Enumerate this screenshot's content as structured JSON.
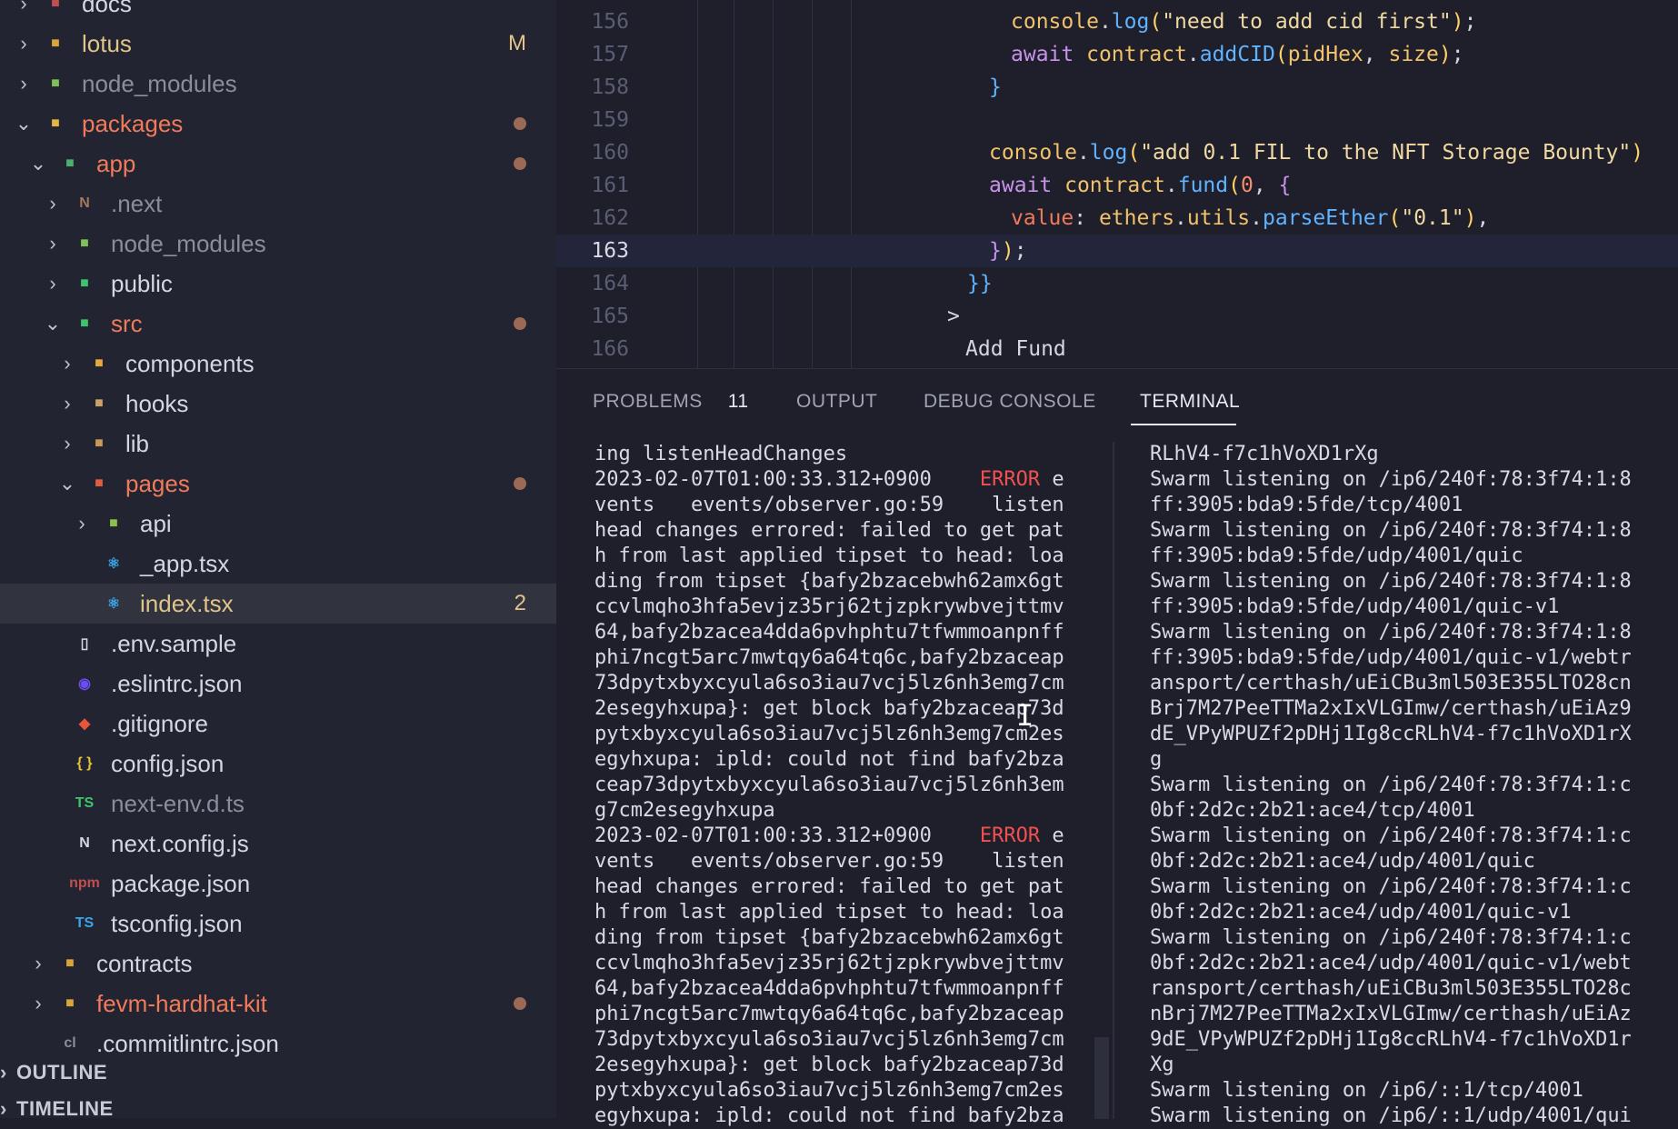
{
  "explorer": {
    "items": [
      {
        "label": "docs",
        "chev": "›",
        "icon_color": "#c0504f",
        "icon_glyph": "■",
        "color": "#d5d7e0"
      },
      {
        "label": "lotus",
        "chev": "›",
        "icon_color": "#d9a53a",
        "icon_glyph": "■",
        "badge": "M",
        "color": "#e0c48a"
      },
      {
        "label": "node_modules",
        "chev": "›",
        "icon_color": "#7ec15a",
        "icon_glyph": "■",
        "color": "#8a8e9c"
      },
      {
        "label": "packages",
        "chev": "⌄",
        "icon_color": "#e7b443",
        "icon_glyph": "■",
        "dot": true,
        "color": "#f07a5a"
      },
      {
        "label": "app",
        "chev": "⌄",
        "icon_color": "#4caf70",
        "icon_glyph": "■",
        "dot": true,
        "color": "#f07a5a"
      },
      {
        "label": ".next",
        "chev": "›",
        "icon_color": "#a07a5a",
        "icon_glyph": "N",
        "color": "#8a8e9c"
      },
      {
        "label": "node_modules",
        "chev": "›",
        "icon_color": "#7ec15a",
        "icon_glyph": "■",
        "color": "#8a8e9c"
      },
      {
        "label": "public",
        "chev": "›",
        "icon_color": "#3ec46a",
        "icon_glyph": "■",
        "color": "#d5d7e0"
      },
      {
        "label": "src",
        "chev": "⌄",
        "icon_color": "#3ec46a",
        "icon_glyph": "■",
        "dot": true,
        "color": "#f07a5a"
      },
      {
        "label": "components",
        "chev": "›",
        "icon_color": "#e7a73b",
        "icon_glyph": "■",
        "color": "#d5d7e0"
      },
      {
        "label": "hooks",
        "chev": "›",
        "icon_color": "#c9a36a",
        "icon_glyph": "■",
        "color": "#d5d7e0"
      },
      {
        "label": "lib",
        "chev": "›",
        "icon_color": "#c89a5a",
        "icon_glyph": "■",
        "color": "#d5d7e0"
      },
      {
        "label": "pages",
        "chev": "⌄",
        "icon_color": "#e25c3f",
        "icon_glyph": "■",
        "dot": true,
        "color": "#f07a5a"
      },
      {
        "label": "api",
        "chev": "›",
        "icon_color": "#8cc04a",
        "icon_glyph": "■",
        "color": "#d5d7e0"
      },
      {
        "label": "_app.tsx",
        "chev": "",
        "icon_color": "#3aa6e8",
        "icon_glyph": "⚛",
        "color": "#d5d7e0"
      },
      {
        "label": "index.tsx",
        "chev": "",
        "icon_color": "#3aa6e8",
        "icon_glyph": "⚛",
        "badge": "2",
        "color": "#e0c48a",
        "selected": true
      },
      {
        "label": ".env.sample",
        "chev": "",
        "icon_color": "#d5d7e0",
        "icon_glyph": "▯",
        "color": "#d5d7e0"
      },
      {
        "label": ".eslintrc.json",
        "chev": "",
        "icon_color": "#6a4cf0",
        "icon_glyph": "◉",
        "color": "#d5d7e0"
      },
      {
        "label": ".gitignore",
        "chev": "",
        "icon_color": "#e8553a",
        "icon_glyph": "◆",
        "color": "#d5d7e0"
      },
      {
        "label": "config.json",
        "chev": "",
        "icon_color": "#e7c23b",
        "icon_glyph": "{ }",
        "color": "#d5d7e0"
      },
      {
        "label": "next-env.d.ts",
        "chev": "",
        "icon_color": "#3ec46a",
        "icon_glyph": "TS",
        "color": "#8a8e9c"
      },
      {
        "label": "next.config.js",
        "chev": "",
        "icon_color": "#d5d7e0",
        "icon_glyph": "N",
        "color": "#d5d7e0"
      },
      {
        "label": "package.json",
        "chev": "",
        "icon_color": "#c0504f",
        "icon_glyph": "npm",
        "color": "#d5d7e0"
      },
      {
        "label": "tsconfig.json",
        "chev": "",
        "icon_color": "#3aa6e8",
        "icon_glyph": "TS",
        "color": "#d5d7e0"
      },
      {
        "label": "contracts",
        "chev": "›",
        "icon_color": "#d9a53a",
        "icon_glyph": "■",
        "color": "#d5d7e0"
      },
      {
        "label": "fevm-hardhat-kit",
        "chev": "›",
        "icon_color": "#d9a53a",
        "icon_glyph": "■",
        "dot": true,
        "color": "#f07a5a"
      },
      {
        "label": ".commitlintrc.json",
        "chev": "",
        "icon_color": "#8a8e9c",
        "icon_glyph": "cl",
        "color": "#d5d7e0"
      }
    ],
    "outline_label": "OUTLINE",
    "timeline_label": "TIMELINE"
  },
  "editor": {
    "current_line": "163",
    "lines": [
      {
        "num": "156",
        "tokens": [
          [
            "console",
            "t-obj"
          ],
          [
            ".",
            "t-pun"
          ],
          [
            "log",
            "t-fn"
          ],
          [
            "(",
            "t-brk"
          ],
          [
            "\"need to add cid first\"",
            "t-str"
          ],
          [
            ")",
            "t-brk"
          ],
          [
            ";",
            "t-pun"
          ]
        ]
      },
      {
        "num": "157",
        "tokens": [
          [
            "await ",
            "t-kw"
          ],
          [
            "contract",
            "t-obj"
          ],
          [
            ".",
            "t-pun"
          ],
          [
            "addCID",
            "t-fn"
          ],
          [
            "(",
            "t-brk"
          ],
          [
            "pidHex",
            "t-obj"
          ],
          [
            ", ",
            "t-pun"
          ],
          [
            "size",
            "t-obj"
          ],
          [
            ")",
            "t-brk"
          ],
          [
            ";",
            "t-pun"
          ]
        ]
      },
      {
        "num": "158",
        "tokens": [
          [
            "}",
            "t-brk2"
          ]
        ]
      },
      {
        "num": "159",
        "tokens": []
      },
      {
        "num": "160",
        "tokens": [
          [
            "console",
            "t-obj"
          ],
          [
            ".",
            "t-pun"
          ],
          [
            "log",
            "t-fn"
          ],
          [
            "(",
            "t-brk"
          ],
          [
            "\"add 0.1 FIL to the NFT Storage Bounty\"",
            "t-str"
          ],
          [
            ")",
            "t-brk"
          ]
        ]
      },
      {
        "num": "161",
        "tokens": [
          [
            "await ",
            "t-kw"
          ],
          [
            "contract",
            "t-obj"
          ],
          [
            ".",
            "t-pun"
          ],
          [
            "fund",
            "t-fn"
          ],
          [
            "(",
            "t-brk"
          ],
          [
            "0",
            "t-num"
          ],
          [
            ", ",
            "t-pun"
          ],
          [
            "{",
            "t-kw"
          ]
        ]
      },
      {
        "num": "162",
        "tokens": [
          [
            "value",
            "t-prop"
          ],
          [
            ": ",
            "t-pun"
          ],
          [
            "ethers",
            "t-obj"
          ],
          [
            ".",
            "t-pun"
          ],
          [
            "utils",
            "t-obj"
          ],
          [
            ".",
            "t-pun"
          ],
          [
            "parseEther",
            "t-fn"
          ],
          [
            "(",
            "t-brk"
          ],
          [
            "\"0.1\"",
            "t-str"
          ],
          [
            ")",
            "t-brk"
          ],
          [
            ",",
            "t-pun"
          ]
        ]
      },
      {
        "num": "163",
        "tokens": [
          [
            "}",
            "t-kw"
          ],
          [
            ")",
            "t-brk"
          ],
          [
            ";",
            "t-pun"
          ]
        ]
      },
      {
        "num": "164",
        "tokens": [
          [
            "}}",
            "t-brk2"
          ]
        ]
      },
      {
        "num": "165",
        "tokens": [
          [
            ">",
            "t-pun"
          ]
        ]
      },
      {
        "num": "166",
        "tokens": [
          [
            "Add Fund",
            "t-pun"
          ]
        ]
      }
    ]
  },
  "panel": {
    "tabs": [
      {
        "label": "PROBLEMS",
        "count": "11"
      },
      {
        "label": "OUTPUT"
      },
      {
        "label": "DEBUG CONSOLE"
      },
      {
        "label": "TERMINAL",
        "active": true
      }
    ],
    "terminal_left": [
      [
        [
          "ing listenHeadChanges",
          ""
        ]
      ],
      [
        [
          "2023-02-07T01:00:33.312+0900    ",
          ""
        ],
        [
          "ERROR",
          "err"
        ],
        [
          " e",
          ""
        ]
      ],
      [
        [
          "vents   events/observer.go:59    listen",
          ""
        ]
      ],
      [
        [
          "head changes errored: failed to get pat",
          ""
        ]
      ],
      [
        [
          "h from last applied tipset to head: loa",
          ""
        ]
      ],
      [
        [
          "ding from tipset {bafy2bzacebwh62amx6gt",
          ""
        ]
      ],
      [
        [
          "ccvlmqho3hfa5evjz35rj62tjzpkrywbvejttmv",
          ""
        ]
      ],
      [
        [
          "64,bafy2bzacea4dda6pvhphtu7tfwmmoanpnff",
          ""
        ]
      ],
      [
        [
          "phi7ncgt5arc7mwtqy6a64tq6c,bafy2bzaceap",
          ""
        ]
      ],
      [
        [
          "73dpytxbyxcyula6so3iau7vcj5lz6nh3emg7cm",
          ""
        ]
      ],
      [
        [
          "2esegyhxupa}: get block bafy2bzaceap73d",
          ""
        ]
      ],
      [
        [
          "pytxbyxcyula6so3iau7vcj5lz6nh3emg7cm2es",
          ""
        ]
      ],
      [
        [
          "egyhxupa: ipld: could not find bafy2bza",
          ""
        ]
      ],
      [
        [
          "ceap73dpytxbyxcyula6so3iau7vcj5lz6nh3em",
          ""
        ]
      ],
      [
        [
          "g7cm2esegyhxupa",
          ""
        ]
      ],
      [
        [
          "2023-02-07T01:00:33.312+0900    ",
          ""
        ],
        [
          "ERROR",
          "err"
        ],
        [
          " e",
          ""
        ]
      ],
      [
        [
          "vents   events/observer.go:59    listen",
          ""
        ]
      ],
      [
        [
          "head changes errored: failed to get pat",
          ""
        ]
      ],
      [
        [
          "h from last applied tipset to head: loa",
          ""
        ]
      ],
      [
        [
          "ding from tipset {bafy2bzacebwh62amx6gt",
          ""
        ]
      ],
      [
        [
          "ccvlmqho3hfa5evjz35rj62tjzpkrywbvejttmv",
          ""
        ]
      ],
      [
        [
          "64,bafy2bzacea4dda6pvhphtu7tfwmmoanpnff",
          ""
        ]
      ],
      [
        [
          "phi7ncgt5arc7mwtqy6a64tq6c,bafy2bzaceap",
          ""
        ]
      ],
      [
        [
          "73dpytxbyxcyula6so3iau7vcj5lz6nh3emg7cm",
          ""
        ]
      ],
      [
        [
          "2esegyhxupa}: get block bafy2bzaceap73d",
          ""
        ]
      ],
      [
        [
          "pytxbyxcyula6so3iau7vcj5lz6nh3emg7cm2es",
          ""
        ]
      ],
      [
        [
          "egyhxupa: ipld: could not find bafy2bza",
          ""
        ]
      ]
    ],
    "terminal_right": [
      "RLhV4-f7c1hVoXD1rXg",
      "Swarm listening on /ip6/240f:78:3f74:1:8",
      "ff:3905:bda9:5fde/tcp/4001",
      "Swarm listening on /ip6/240f:78:3f74:1:8",
      "ff:3905:bda9:5fde/udp/4001/quic",
      "Swarm listening on /ip6/240f:78:3f74:1:8",
      "ff:3905:bda9:5fde/udp/4001/quic-v1",
      "Swarm listening on /ip6/240f:78:3f74:1:8",
      "ff:3905:bda9:5fde/udp/4001/quic-v1/webtr",
      "ansport/certhash/uEiCBu3ml503E355LTO28cn",
      "Brj7M27PeeTTMa2xIxVLGImw/certhash/uEiAz9",
      "dE_VPyWPUZf2pDHj1Ig8ccRLhV4-f7c1hVoXD1rX",
      "g",
      "Swarm listening on /ip6/240f:78:3f74:1:c",
      "0bf:2d2c:2b21:ace4/tcp/4001",
      "Swarm listening on /ip6/240f:78:3f74:1:c",
      "0bf:2d2c:2b21:ace4/udp/4001/quic",
      "Swarm listening on /ip6/240f:78:3f74:1:c",
      "0bf:2d2c:2b21:ace4/udp/4001/quic-v1",
      "Swarm listening on /ip6/240f:78:3f74:1:c",
      "0bf:2d2c:2b21:ace4/udp/4001/quic-v1/webt",
      "ransport/certhash/uEiCBu3ml503E355LTO28c",
      "nBrj7M27PeeTTMa2xIxVLGImw/certhash/uEiAz",
      "9dE_VPyWPUZf2pDHj1Ig8ccRLhV4-f7c1hVoXD1r",
      "Xg",
      "Swarm listening on /ip6/::1/tcp/4001",
      "Swarm listening on /ip6/::1/udp/4001/qui"
    ]
  }
}
